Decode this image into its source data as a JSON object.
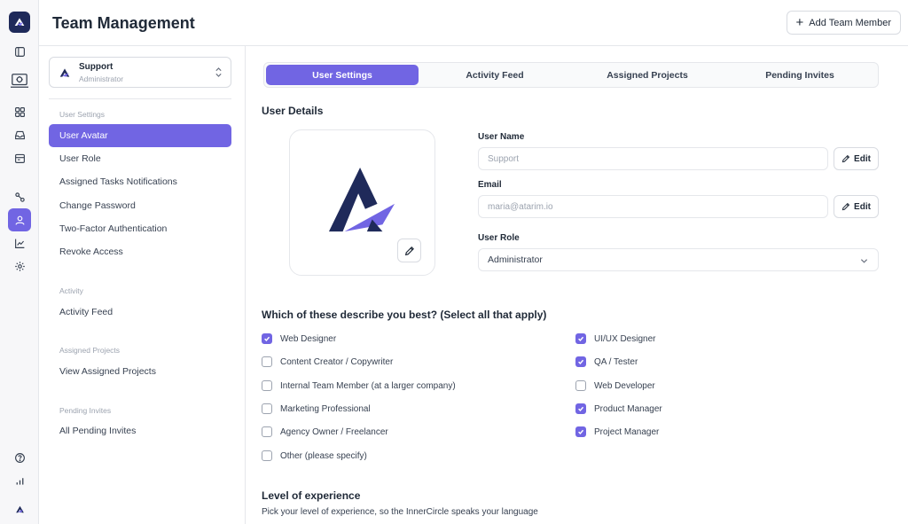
{
  "header": {
    "title": "Team Management",
    "add_button_label": "Add Team Member"
  },
  "account": {
    "name": "Support",
    "role": "Administrator"
  },
  "sidebar": {
    "sections": [
      {
        "label": "User Settings",
        "items": [
          "User Avatar",
          "User Role",
          "Assigned Tasks Notifications",
          "Change Password",
          "Two-Factor Authentication",
          "Revoke Access"
        ]
      },
      {
        "label": "Activity",
        "items": [
          "Activity Feed"
        ]
      },
      {
        "label": "Assigned Projects",
        "items": [
          "View Assigned Projects"
        ]
      },
      {
        "label": "Pending Invites",
        "items": [
          "All Pending Invites"
        ]
      }
    ],
    "active_item": "User Avatar"
  },
  "tabs": [
    "User Settings",
    "Activity Feed",
    "Assigned Projects",
    "Pending Invites"
  ],
  "active_tab": "User Settings",
  "user_details": {
    "title": "User Details",
    "username_label": "User Name",
    "username_placeholder": "Support",
    "email_label": "Email",
    "email_placeholder": "maria@atarim.io",
    "edit_label": "Edit",
    "role_label": "User Role",
    "role_value": "Administrator"
  },
  "describe": {
    "title": "Which of these describe you best? (Select all that apply)",
    "left": [
      {
        "label": "Web Designer",
        "checked": true
      },
      {
        "label": "Content Creator / Copywriter",
        "checked": false
      },
      {
        "label": "Internal Team Member (at a larger company)",
        "checked": false
      },
      {
        "label": "Marketing Professional",
        "checked": false
      },
      {
        "label": "Agency Owner / Freelancer",
        "checked": false
      },
      {
        "label": "Other (please specify)",
        "checked": false
      }
    ],
    "right": [
      {
        "label": "UI/UX Designer",
        "checked": true
      },
      {
        "label": "QA / Tester",
        "checked": true
      },
      {
        "label": "Web Developer",
        "checked": false
      },
      {
        "label": "Product Manager",
        "checked": true
      },
      {
        "label": "Project Manager",
        "checked": true
      }
    ]
  },
  "experience": {
    "title": "Level of experience",
    "subtitle": "Pick your level of experience, so the InnerCircle speaks your language"
  },
  "colors": {
    "accent": "#7165e3",
    "brand_navy": "#1f2a5a"
  },
  "icons": [
    "app-logo-icon",
    "sidebar-toggle-icon",
    "device-icon",
    "grid-icon",
    "inbox-icon",
    "calendar-icon",
    "connections-icon",
    "user-icon",
    "chart-icon",
    "settings-icon",
    "help-icon",
    "stats-icon",
    "plus-icon",
    "chevron-updown-icon",
    "pencil-icon",
    "chevron-down-icon",
    "checkmark-icon"
  ]
}
